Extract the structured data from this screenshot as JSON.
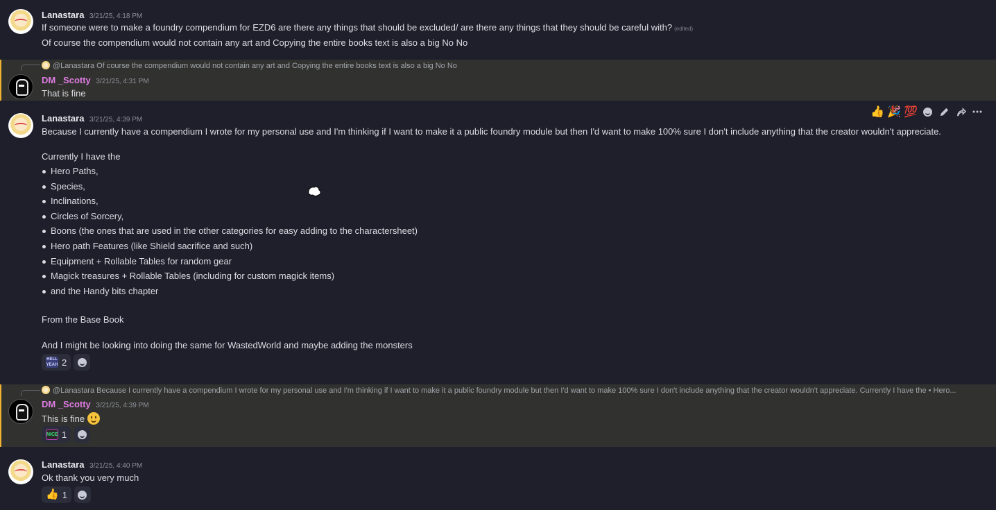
{
  "messages": {
    "m1": {
      "author": "Lanastara",
      "timestamp": "3/21/25, 4:18 PM",
      "line1": "If someone were to make a foundry compendium for EZD6 are there any things that should be excluded/ are there any things that they should be careful with?",
      "edited": "(edited)",
      "line2": "Of course the compendium would not contain any art and Copying the entire books text is also a big No No"
    },
    "m2": {
      "reply_preview": "@Lanastara Of course the compendium would not contain any art and Copying the entire books text is also a big No No",
      "author": "DM _Scotty",
      "timestamp": "3/21/25, 4:31 PM",
      "text": "That is fine"
    },
    "m3": {
      "author": "Lanastara",
      "timestamp": "3/21/25, 4:39 PM",
      "intro": "Because I currently have a compendium I wrote for my personal use and I'm thinking if I want to make it a public foundry module but then I'd want to make 100% sure I don't include anything that the creator wouldn't appreciate.",
      "list_intro": "Currently I have the",
      "items": [
        "Hero Paths,",
        "Species,",
        "Inclinations,",
        "Circles of Sorcery,",
        "Boons (the ones that are used in the other categories for easy adding to the charactersheet)",
        "Hero path Features (like Shield sacrifice and such)",
        "Equipment + Rollable Tables for random gear",
        "Magick treasures + Rollable Tables (including for custom magick items)",
        "and the Handy bits chapter"
      ],
      "from": "From the Base Book",
      "outro": "And I might be looking into doing the same for WastedWorld and maybe adding the monsters",
      "reaction_label": "HELL YEAH",
      "reaction_count": "2"
    },
    "m4": {
      "reply_preview": "@Lanastara Because I currently have a compendium I wrote for my personal use and I'm thinking if I want to make it a public foundry module but then I'd want to make 100% sure I don't include anything that the creator wouldn't appreciate.  Currently I have the  • Hero...",
      "author": "DM _Scotty",
      "timestamp": "3/21/25, 4:39 PM",
      "text": "This is fine",
      "reaction_label": "NICE",
      "reaction_count": "1"
    },
    "m5": {
      "author": "Lanastara",
      "timestamp": "3/21/25, 4:40 PM",
      "text": "Ok thank you very much",
      "reaction_emoji": "👍",
      "reaction_count": "1"
    }
  },
  "toolbar": {
    "quick_reactions": [
      "👍",
      "🎉",
      "💯"
    ]
  },
  "colors": {
    "background": "#1e1f2b",
    "mention_highlight": "#31322f",
    "mention_bar": "#f0b232",
    "dm_name": "#e07ce4"
  }
}
